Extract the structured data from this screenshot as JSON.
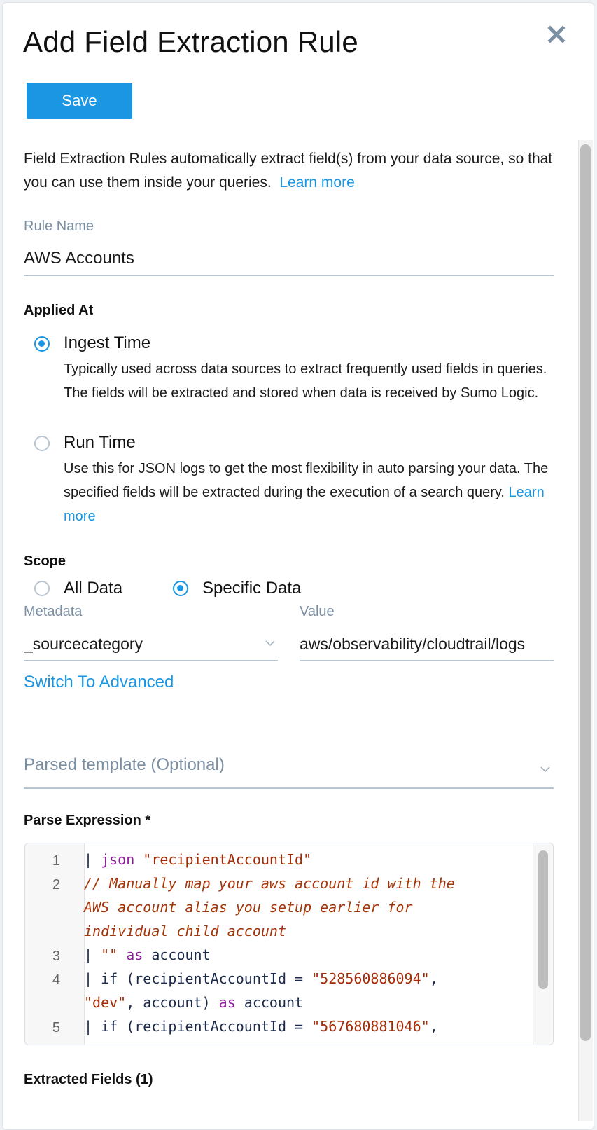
{
  "dialog": {
    "title": "Add Field Extraction Rule",
    "close_icon": "close-icon",
    "save_label": "Save"
  },
  "description": {
    "text": "Field Extraction Rules automatically extract field(s) from your data source, so that you can use them inside your queries.",
    "learn_more": "Learn more"
  },
  "rule_name": {
    "label": "Rule Name",
    "value": "AWS Accounts"
  },
  "applied_at": {
    "label": "Applied At",
    "options": [
      {
        "label": "Ingest Time",
        "selected": true,
        "description": "Typically used across data sources to extract frequently used fields in queries. The fields will be extracted and stored when data is received by Sumo Logic."
      },
      {
        "label": "Run Time",
        "selected": false,
        "description": "Use this for JSON logs to get the most flexibility in auto parsing your data. The specified fields will be extracted during the execution of a search query.",
        "learn_more": "Learn more"
      }
    ]
  },
  "scope": {
    "label": "Scope",
    "options": [
      {
        "label": "All Data",
        "selected": false
      },
      {
        "label": "Specific Data",
        "selected": true
      }
    ],
    "metadata_label": "Metadata",
    "metadata_value": "_sourcecategory",
    "value_label": "Value",
    "value_value": "aws/observability/cloudtrail/logs",
    "switch_advanced": "Switch To Advanced"
  },
  "parsed_template": {
    "placeholder": "Parsed template (Optional)"
  },
  "parse_expression": {
    "label": "Parse Expression *",
    "line_numbers": [
      "1",
      "2",
      "",
      "",
      "3",
      "4",
      "",
      "5"
    ],
    "lines": [
      [
        {
          "t": "| ",
          "c": "plain"
        },
        {
          "t": "json",
          "c": "kw"
        },
        {
          "t": " \"recipientAccountId\"",
          "c": "str"
        }
      ],
      [
        {
          "t": "// Manually map your aws account id with the",
          "c": "cm"
        }
      ],
      [
        {
          "t": "AWS account alias you setup earlier for",
          "c": "cm"
        }
      ],
      [
        {
          "t": "individual child account",
          "c": "cm"
        }
      ],
      [
        {
          "t": "| ",
          "c": "plain"
        },
        {
          "t": "\"\"",
          "c": "str"
        },
        {
          "t": " as",
          "c": "kw"
        },
        {
          "t": " account",
          "c": "plain"
        }
      ],
      [
        {
          "t": "| if (recipientAccountId = ",
          "c": "plain"
        },
        {
          "t": "\"528560886094\"",
          "c": "str"
        },
        {
          "t": ",",
          "c": "plain"
        }
      ],
      [
        {
          "t": "\"dev\"",
          "c": "str"
        },
        {
          "t": ", account) ",
          "c": "plain"
        },
        {
          "t": "as",
          "c": "kw"
        },
        {
          "t": " account",
          "c": "plain"
        }
      ],
      [
        {
          "t": "| if (recipientAccountId = ",
          "c": "plain"
        },
        {
          "t": "\"567680881046\"",
          "c": "str"
        },
        {
          "t": ",",
          "c": "plain"
        }
      ]
    ]
  },
  "extracted_fields": {
    "label": "Extracted Fields (1)"
  },
  "colors": {
    "accent": "#1a96e3",
    "label_gray": "#7b8fa3",
    "code_keyword": "#8e1e9a",
    "code_string": "#a52a05"
  }
}
